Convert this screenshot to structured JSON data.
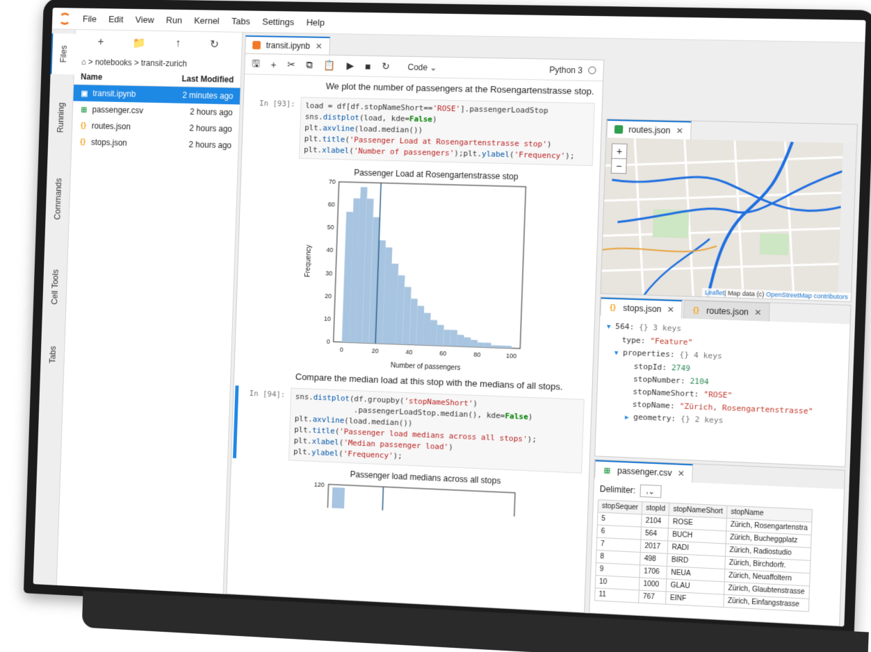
{
  "menu": [
    "File",
    "Edit",
    "View",
    "Run",
    "Kernel",
    "Tabs",
    "Settings",
    "Help"
  ],
  "rail": [
    "Files",
    "Running",
    "Commands",
    "Cell Tools",
    "Tabs"
  ],
  "filebrowser": {
    "breadcrumb": "⌂ > notebooks > transit-zurich",
    "col_name": "Name",
    "col_modified": "Last Modified",
    "files": [
      {
        "name": "transit.ipynb",
        "modified": "2 minutes ago"
      },
      {
        "name": "passenger.csv",
        "modified": "2 hours ago"
      },
      {
        "name": "routes.json",
        "modified": "2 hours ago"
      },
      {
        "name": "stops.json",
        "modified": "2 hours ago"
      }
    ]
  },
  "notebook": {
    "tab": "transit.ipynb",
    "cell_type": "Code",
    "kernel": "Python 3",
    "md1": "We plot the number of passengers at the Rosengartenstrasse stop.",
    "prompt1": "In [93]:",
    "md2": "Compare the median load at this stop with the medians of all stops.",
    "prompt2": "In [94]:"
  },
  "plot1": {
    "title": "Passenger Load at Rosengartenstrasse stop",
    "xlabel": "Number of passengers",
    "ylabel": "Frequency",
    "yticks": [
      "0",
      "10",
      "20",
      "30",
      "40",
      "50",
      "60",
      "70"
    ],
    "xticks": [
      "0",
      "20",
      "40",
      "60",
      "80",
      "100"
    ]
  },
  "plot2": {
    "title": "Passenger load medians across all stops",
    "ytick": "120"
  },
  "chart_data": [
    {
      "type": "bar",
      "title": "Passenger Load at Rosengartenstrasse stop",
      "xlabel": "Number of passengers",
      "ylabel": "Frequency",
      "xlim": [
        -5,
        105
      ],
      "ylim": [
        0,
        70
      ],
      "bin_edges": [
        0,
        4,
        8,
        12,
        16,
        20,
        24,
        28,
        32,
        36,
        40,
        44,
        48,
        52,
        56,
        60,
        64,
        68,
        72,
        76,
        80,
        84,
        88,
        92,
        96,
        100
      ],
      "values": [
        57,
        63,
        68,
        63,
        55,
        45,
        42,
        35,
        30,
        25,
        20,
        17,
        14,
        11,
        9,
        7,
        7,
        5,
        4,
        3,
        2,
        2,
        1,
        1,
        1
      ],
      "vline": 20
    },
    {
      "type": "bar",
      "title": "Passenger load medians across all stops",
      "yticks": [
        "120"
      ]
    }
  ],
  "routes_tab": "routes.json",
  "map_attrib": {
    "leaflet": "Leaflet",
    "text": "| Map data (c) ",
    "osm": "OpenStreetMap contributors"
  },
  "stops": {
    "tabs": [
      "stops.json",
      "routes.json"
    ],
    "lines": {
      "l1_key": "564:",
      "l1_meta": "{} 3 keys",
      "l2_key": "type:",
      "l2_val": "\"Feature\"",
      "l3_key": "properties:",
      "l3_meta": "{} 4 keys",
      "l4_key": "stopId:",
      "l4_val": "2749",
      "l5_key": "stopNumber:",
      "l5_val": "2104",
      "l6_key": "stopNameShort:",
      "l6_val": "\"ROSE\"",
      "l7_key": "stopName:",
      "l7_val": "\"Zürich, Rosengartenstrasse\"",
      "l8_key": "geometry:",
      "l8_meta": "{} 2 keys"
    }
  },
  "csv": {
    "tab": "passenger.csv",
    "delimiter_label": "Delimiter:",
    "delimiter_value": ",",
    "headers": [
      "stopSequer",
      "stopId",
      "stopNameShort",
      "stopName"
    ],
    "rows": [
      [
        "5",
        "2104",
        "ROSE",
        "Zürich, Rosengartenstra"
      ],
      [
        "6",
        "564",
        "BUCH",
        "Zürich, Bucheggplatz"
      ],
      [
        "7",
        "2017",
        "RADI",
        "Zürich, Radiostudio"
      ],
      [
        "8",
        "498",
        "BIRD",
        "Zürich, Birchdorfr."
      ],
      [
        "9",
        "1706",
        "NEUA",
        "Zürich, Neuaffoltern"
      ],
      [
        "10",
        "1000",
        "GLAU",
        "Zürich, Glaubtenstrasse"
      ],
      [
        "11",
        "767",
        "EINF",
        "Zürich, Einfangstrasse"
      ]
    ]
  }
}
